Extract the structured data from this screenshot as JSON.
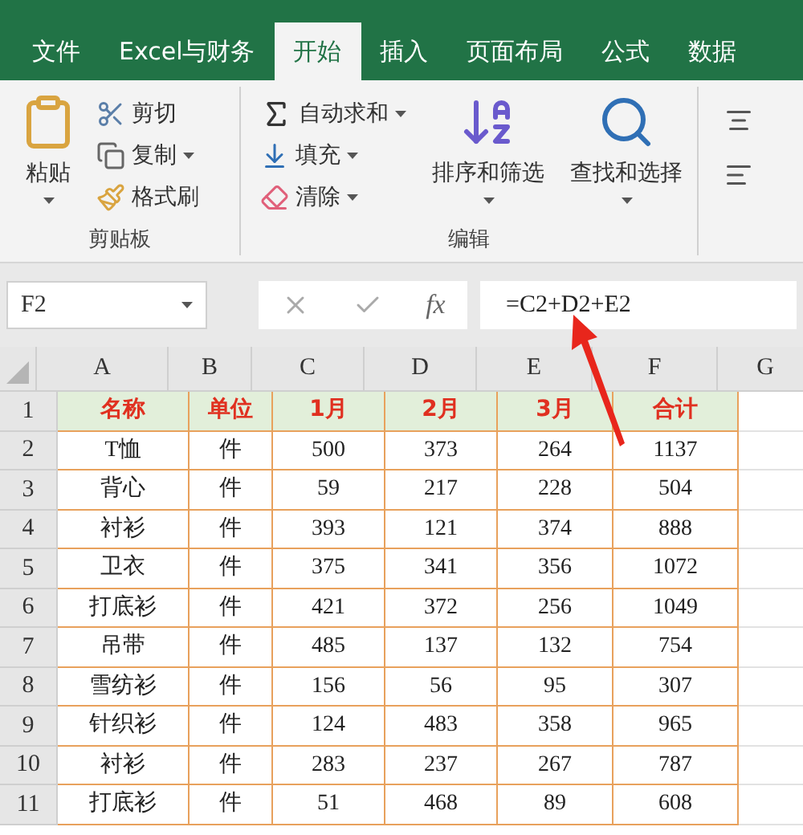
{
  "tabs": [
    {
      "label": "文件",
      "selected": false
    },
    {
      "label": "Excel与财务",
      "selected": false
    },
    {
      "label": "开始",
      "selected": true
    },
    {
      "label": "插入",
      "selected": false
    },
    {
      "label": "页面布局",
      "selected": false
    },
    {
      "label": "公式",
      "selected": false
    },
    {
      "label": "数据",
      "selected": false
    }
  ],
  "ribbon": {
    "groups": [
      {
        "label": "剪贴板",
        "large": [
          {
            "label": "粘贴",
            "dropdown": true
          }
        ],
        "small": [
          {
            "label": "剪切",
            "dropdown": false
          },
          {
            "label": "复制",
            "dropdown": true
          },
          {
            "label": "格式刷",
            "dropdown": false
          }
        ]
      },
      {
        "label": "编辑",
        "small": [
          {
            "label": "自动求和",
            "dropdown": true
          },
          {
            "label": "填充",
            "dropdown": true
          },
          {
            "label": "清除",
            "dropdown": true
          }
        ],
        "large": [
          {
            "label": "排序和筛选",
            "dropdown": true
          },
          {
            "label": "查找和选择",
            "dropdown": true
          }
        ]
      }
    ]
  },
  "formula_bar": {
    "name_box": "F2",
    "function_label": "fx",
    "formula": "=C2+D2+E2"
  },
  "sheet": {
    "columns": [
      "A",
      "B",
      "C",
      "D",
      "E",
      "F",
      "G"
    ],
    "rows": [
      {
        "number": "1",
        "cells": [
          "名称",
          "单位",
          "1月",
          "2月",
          "3月",
          "合计"
        ]
      },
      {
        "number": "2",
        "cells": [
          "T恤",
          "件",
          "500",
          "373",
          "264",
          "1137"
        ]
      },
      {
        "number": "3",
        "cells": [
          "背心",
          "件",
          "59",
          "217",
          "228",
          "504"
        ]
      },
      {
        "number": "4",
        "cells": [
          "衬衫",
          "件",
          "393",
          "121",
          "374",
          "888"
        ]
      },
      {
        "number": "5",
        "cells": [
          "卫衣",
          "件",
          "375",
          "341",
          "356",
          "1072"
        ]
      },
      {
        "number": "6",
        "cells": [
          "打底衫",
          "件",
          "421",
          "372",
          "256",
          "1049"
        ]
      },
      {
        "number": "7",
        "cells": [
          "吊带",
          "件",
          "485",
          "137",
          "132",
          "754"
        ]
      },
      {
        "number": "8",
        "cells": [
          "雪纺衫",
          "件",
          "156",
          "56",
          "95",
          "307"
        ]
      },
      {
        "number": "9",
        "cells": [
          "针织衫",
          "件",
          "124",
          "483",
          "358",
          "965"
        ]
      },
      {
        "number": "10",
        "cells": [
          "衬衫",
          "件",
          "283",
          "237",
          "267",
          "787"
        ]
      },
      {
        "number": "11",
        "cells": [
          "打底衫",
          "件",
          "51",
          "468",
          "89",
          "608"
        ]
      }
    ]
  }
}
